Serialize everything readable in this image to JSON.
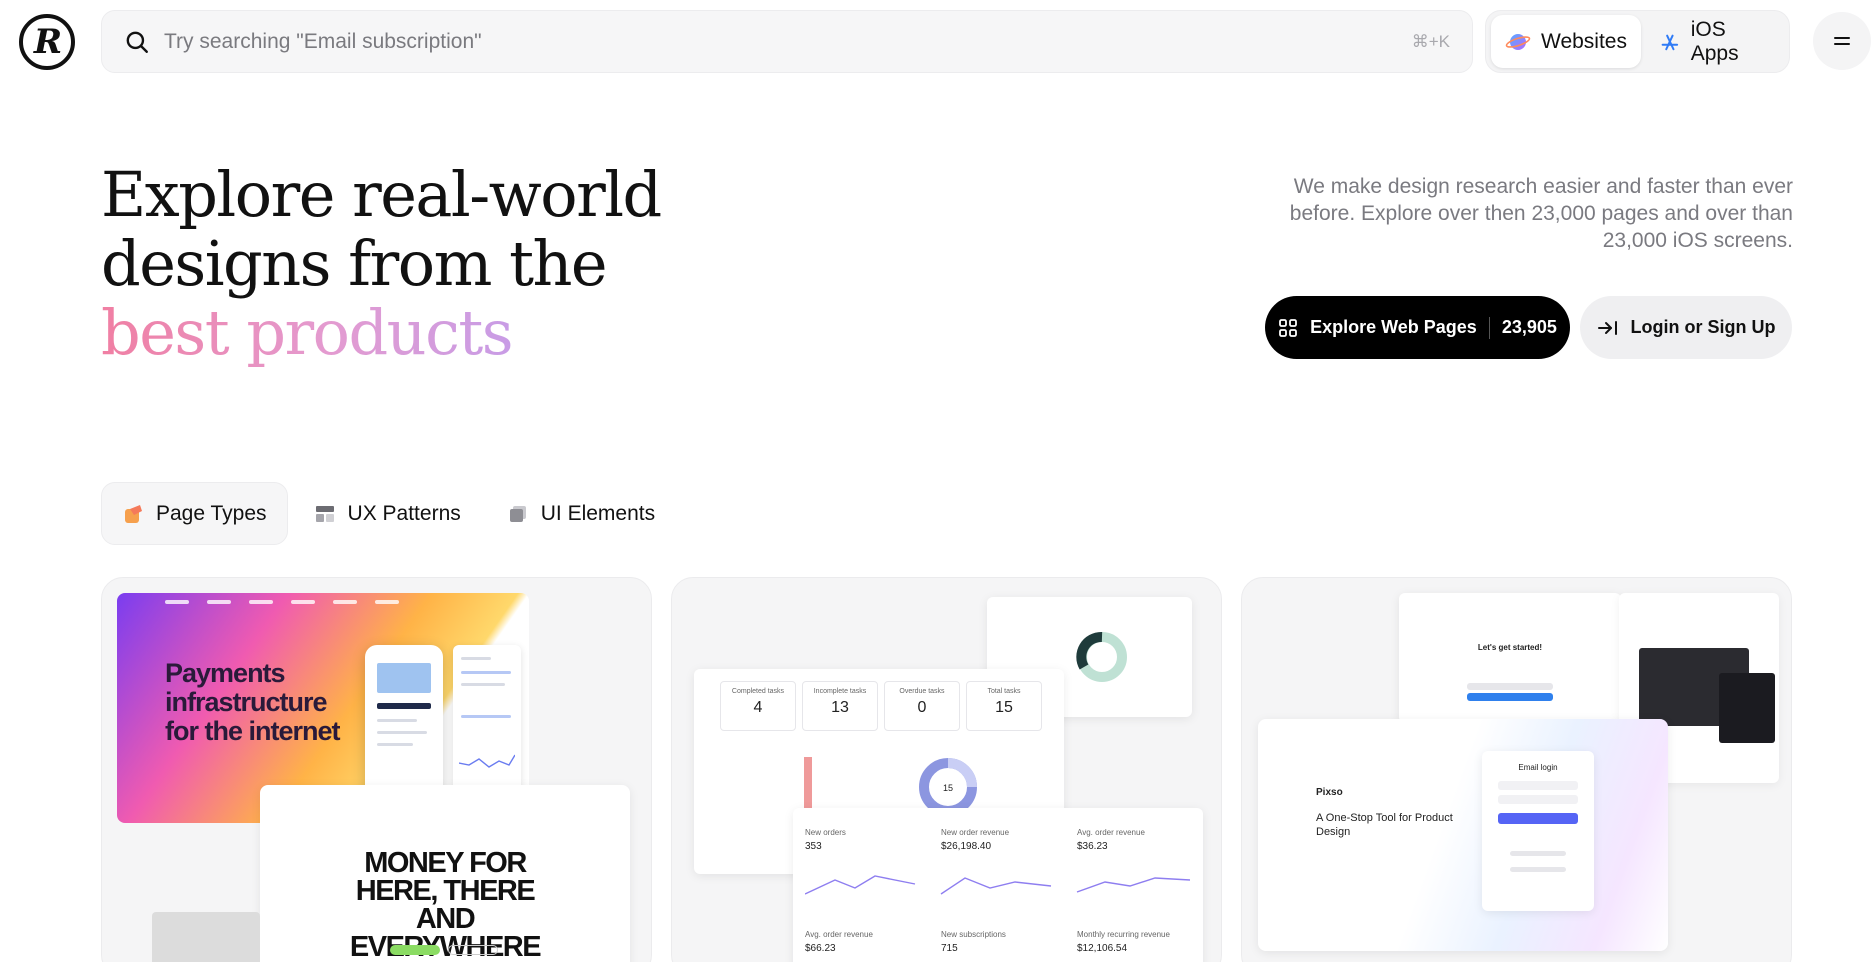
{
  "brand": {
    "logo_glyph": "R"
  },
  "search": {
    "placeholder": "Try searching \"Email subscription\"",
    "shortcut": "⌘+K"
  },
  "platform_switch": {
    "items": [
      {
        "label": "Websites",
        "icon": "globe-icon",
        "active": true
      },
      {
        "label": "iOS Apps",
        "icon": "app-store-icon",
        "active": false
      }
    ]
  },
  "hero": {
    "title_line1": "Explore real-world",
    "title_line2": "designs from the",
    "title_line3": "best products",
    "description": "We make design research easier and faster than ever before. Explore over then 23,000 pages and over than 23,000 iOS screens."
  },
  "cta": {
    "primary_label": "Explore Web Pages",
    "primary_count": "23,905",
    "secondary_label": "Login or Sign Up"
  },
  "category_tabs": [
    {
      "label": "Page Types",
      "icon": "page-types-icon",
      "active": true
    },
    {
      "label": "UX Patterns",
      "icon": "ux-patterns-icon",
      "active": false
    },
    {
      "label": "UI Elements",
      "icon": "ui-elements-icon",
      "active": false
    }
  ],
  "cards": {
    "card1": {
      "headline": "Payments infrastructure for the internet",
      "money_headline": "MONEY FOR HERE, THERE AND EVERYWHERE"
    },
    "card2": {
      "stats": [
        {
          "label": "Completed tasks",
          "value": "4"
        },
        {
          "label": "Incomplete tasks",
          "value": "13"
        },
        {
          "label": "Overdue tasks",
          "value": "0"
        },
        {
          "label": "Total tasks",
          "value": "15"
        }
      ],
      "donut_value": "15",
      "metrics": [
        {
          "label": "New orders",
          "value": "353"
        },
        {
          "label": "New order revenue",
          "value": "$26,198.40"
        },
        {
          "label": "Avg. order revenue",
          "value": "$36.23"
        },
        {
          "label": "Avg. order revenue",
          "value": "$66.23"
        },
        {
          "label": "New subscriptions",
          "value": "715"
        },
        {
          "label": "Monthly recurring revenue",
          "value": "$12,106.54"
        }
      ]
    },
    "card3": {
      "brand": "Pixso",
      "tagline": "A One-Stop Tool for Product Design",
      "login_title": "Email login",
      "craft_title": "Let's get started!"
    }
  },
  "colors": {
    "accent_black": "#000000",
    "hero_gradient_start": "#f07fa3",
    "hero_gradient_end": "#c89ce6",
    "surface": "#f5f5f6"
  }
}
